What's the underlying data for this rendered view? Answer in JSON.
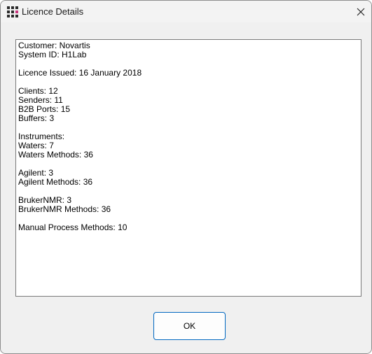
{
  "window": {
    "title": "Licence Details",
    "icon": "grid-app-icon",
    "close_icon": "close-icon"
  },
  "details": {
    "lines": [
      "Customer: Novartis",
      "System ID: H1Lab",
      "",
      "Licence Issued: 16 January 2018",
      "",
      "Clients: 12",
      "Senders: 11",
      "B2B Ports: 15",
      "Buffers: 3",
      "",
      "Instruments:",
      "Waters: 7",
      "Waters Methods: 36",
      "",
      "Agilent: 3",
      "Agilent Methods: 36",
      "",
      "BrukerNMR: 3",
      "BrukerNMR Methods: 36",
      "",
      "Manual Process Methods: 10"
    ]
  },
  "buttons": {
    "ok_label": "OK"
  },
  "colors": {
    "accent": "#0067c0",
    "icon_highlight": "#c9357d"
  }
}
